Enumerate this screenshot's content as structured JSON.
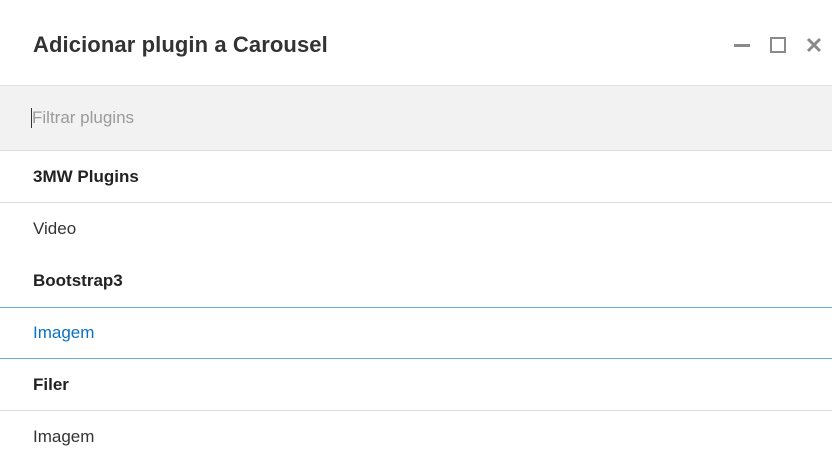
{
  "dialog": {
    "title": "Adicionar plugin a Carousel",
    "controls": {
      "minimize_icon": "minimize-icon",
      "maximize_icon": "maximize-icon",
      "close_icon": "close-icon"
    }
  },
  "search": {
    "value": "",
    "placeholder": "Filtrar plugins"
  },
  "groups": [
    {
      "name": "3MW Plugins",
      "items": [
        {
          "label": "Video"
        }
      ]
    },
    {
      "name": "Bootstrap3",
      "items": [
        {
          "label": "Imagem"
        }
      ]
    },
    {
      "name": "Filer",
      "items": [
        {
          "label": "Imagem"
        }
      ]
    }
  ],
  "colors": {
    "title_text": "#333333",
    "search_bg": "#f2f2f2",
    "active_item_text": "#0b71c1",
    "active_item_border": "#66b0e0",
    "separator": "#dddddd",
    "icon_gray": "#8a8a8a"
  }
}
